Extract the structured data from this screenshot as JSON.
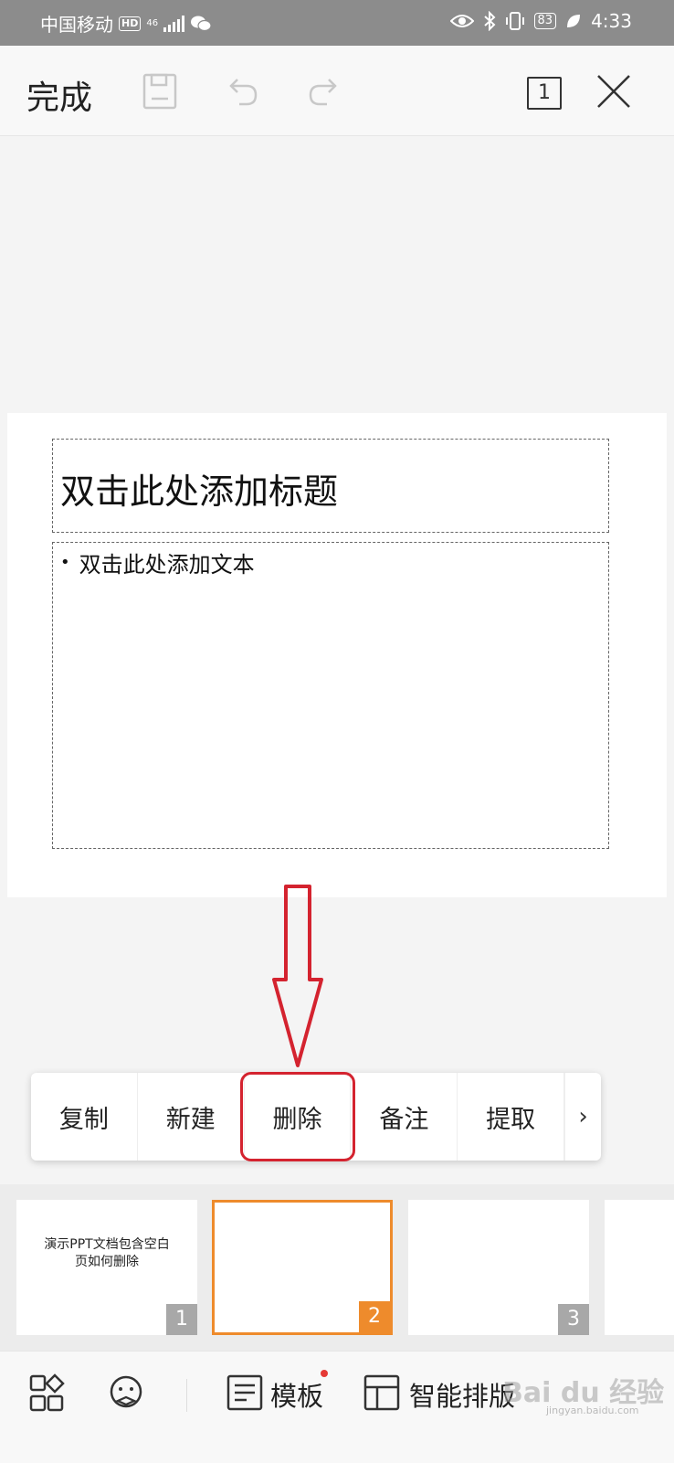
{
  "status_bar": {
    "carrier": "中国移动",
    "hd": "HD",
    "network": "46",
    "battery": "83",
    "time": "4:33"
  },
  "toolbar": {
    "done_label": "完成",
    "page_count": "1",
    "icons": [
      "save-icon",
      "undo-icon",
      "redo-icon",
      "close-icon"
    ]
  },
  "slide": {
    "title_placeholder": "双击此处添加标题",
    "body_placeholder": "双击此处添加文本",
    "bullet": "•"
  },
  "context_menu": {
    "items": [
      "复制",
      "新建",
      "删除",
      "备注",
      "提取"
    ],
    "more": "›",
    "highlighted_item": "删除"
  },
  "thumbnails": [
    {
      "number": "1",
      "text_line1": "演示PPT文档包含空白",
      "text_line2": "页如何删除",
      "selected": false
    },
    {
      "number": "2",
      "text_line1": "",
      "text_line2": "",
      "selected": true
    },
    {
      "number": "3",
      "text_line1": "",
      "text_line2": "",
      "selected": false
    }
  ],
  "bottom_bar": {
    "template_label": "模板",
    "smart_layout_label": "智能排版",
    "watermark": "Bai du 经验",
    "watermark_sub": "jingyan.baidu.com"
  },
  "colors": {
    "accent_orange": "#ee8b2c",
    "annotation_red": "#d4232f",
    "status_bar": "#8c8c8c"
  }
}
